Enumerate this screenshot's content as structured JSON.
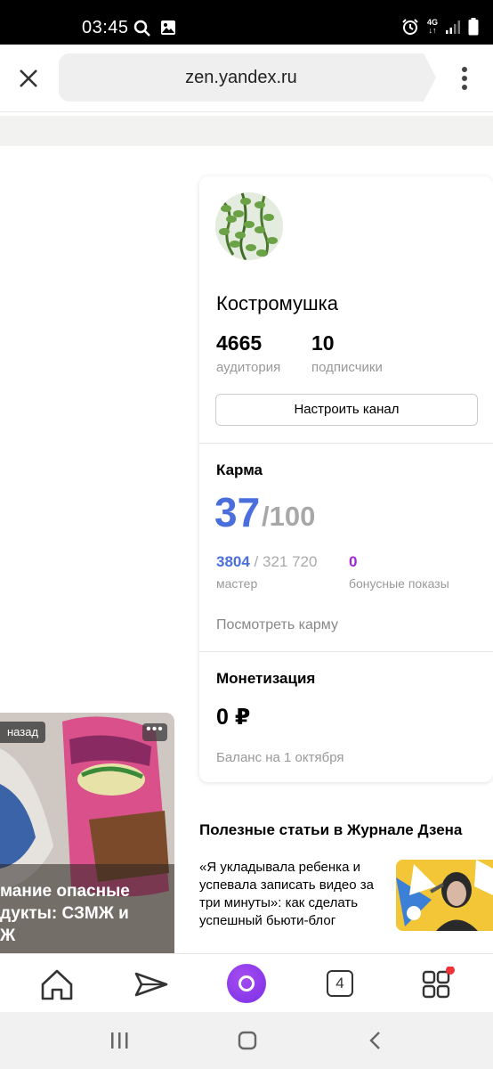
{
  "status_bar": {
    "time": "03:45",
    "network_label": "4G",
    "icons": [
      "search-icon",
      "image-icon",
      "alarm-icon",
      "signal-icon",
      "battery-icon"
    ]
  },
  "browser": {
    "url": "zen.yandex.ru",
    "icons": [
      "close-icon",
      "more-vert-icon"
    ]
  },
  "profile": {
    "name": "Костромушка",
    "audience_value": "4665",
    "audience_label": "аудитория",
    "subscribers_value": "10",
    "subscribers_label": "подписчики",
    "setup_button": "Настроить канал"
  },
  "karma": {
    "title": "Карма",
    "value": "37",
    "max": "/100",
    "rank_current": "3804",
    "rank_sep": " / ",
    "rank_total": "321 720",
    "rank_label": "мастер",
    "bonus_value": "0",
    "bonus_label": "бонусные показы",
    "link": "Посмотреть карму"
  },
  "monetization": {
    "title": "Монетизация",
    "value": "0 ₽",
    "balance": "Баланс на 1 октября"
  },
  "feed_card": {
    "tag": "назад",
    "more": "•••",
    "title": "мание опасные\nдукты: СЗМЖ и\nЖ"
  },
  "journal": {
    "title": "Полезные статьи в Журнале Дзена",
    "article": "«Я укладывала ребенка и успевала записать видео за три минуты»: как сделать успешный бьюти-блог"
  },
  "bottom_nav": {
    "tabs_count": "4",
    "items": [
      "home-icon",
      "send-icon",
      "alice-icon",
      "tabs-icon",
      "services-icon"
    ]
  },
  "colors": {
    "accent_blue": "#4a6fdc",
    "bonus_purple": "#a326d8",
    "alice_purple": "#8a3be9",
    "notification_red": "#f0333a"
  }
}
